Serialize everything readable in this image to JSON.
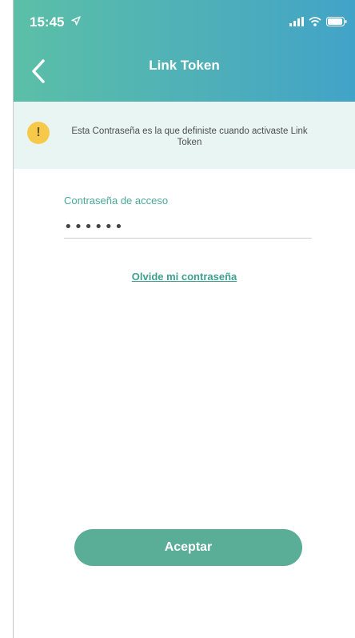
{
  "status_bar": {
    "time": "15:45"
  },
  "header": {
    "title": "Link Token"
  },
  "notice": {
    "text": "Esta Contraseña es la que definiste cuando activaste Link Token"
  },
  "form": {
    "password_label": "Contraseña de acceso",
    "password_value": "••••••",
    "forgot_link": "Olvide mi contraseña"
  },
  "actions": {
    "accept_label": "Aceptar"
  },
  "colors": {
    "header_start": "#5bbfa7",
    "header_end": "#42a3c8",
    "accent": "#4aa89b",
    "button": "#5aad96",
    "warning": "#f7c94a",
    "notice_bg": "#e9f5f3"
  },
  "icons": [
    "location-arrow-icon",
    "signal-icon",
    "wifi-icon",
    "battery-icon",
    "chevron-left-icon",
    "warning-icon"
  ]
}
